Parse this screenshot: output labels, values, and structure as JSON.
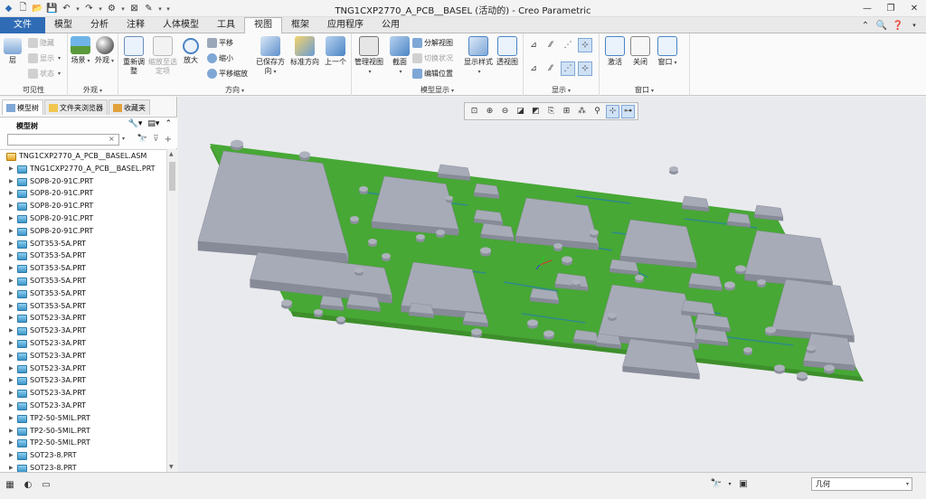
{
  "window": {
    "title": "TNG1CXP2770_A_PCB__BASEL (活动的) - Creo Parametric"
  },
  "ribbon_tabs": [
    {
      "label": "文件"
    },
    {
      "label": "模型"
    },
    {
      "label": "分析"
    },
    {
      "label": "注释"
    },
    {
      "label": "人体模型"
    },
    {
      "label": "工具"
    },
    {
      "label": "视图"
    },
    {
      "label": "框架"
    },
    {
      "label": "应用程序"
    },
    {
      "label": "公用"
    }
  ],
  "active_tab": "视图",
  "ribbon": {
    "visibility": {
      "label": "可见性",
      "layer": "层",
      "hide": "隐藏",
      "show": "显示",
      "status": "状态"
    },
    "appearance": {
      "label": "外观",
      "scene": "场景",
      "appearance": "外观"
    },
    "orientation": {
      "label": "方向",
      "refit": "重新调整",
      "zoom_to_selected": "缩放至选定项",
      "zoom_in": "放大",
      "pan": "平移",
      "zoom_out": "缩小",
      "pan_zoom": "平移缩放",
      "saved_views": "已保存方向",
      "standard_orientation": "标准方向",
      "previous": "上一个"
    },
    "model_display": {
      "label": "模型显示",
      "manage_views": "管理视图",
      "section": "截面",
      "exploded_view": "分解视图",
      "toggle_status": "切换状况",
      "edit_position": "编辑位置",
      "display_style": "显示样式",
      "perspective": "透视图"
    },
    "display": {
      "label": "显示"
    },
    "window": {
      "label": "窗口",
      "activate": "激活",
      "close": "关闭",
      "windows": "窗口"
    }
  },
  "panel": {
    "tabs": [
      {
        "label": "模型树"
      },
      {
        "label": "文件夹浏览器"
      },
      {
        "label": "收藏夹"
      }
    ],
    "tree_title": "模型树",
    "search_value": "",
    "tree": {
      "root": "TNG1CXP2770_A_PCB__BASEL.ASM",
      "items": [
        "TNG1CXP2770_A_PCB__BASEL.PRT",
        "SOP8-20-91C.PRT",
        "SOP8-20-91C.PRT",
        "SOP8-20-91C.PRT",
        "SOP8-20-91C.PRT",
        "SOP8-20-91C.PRT",
        "SOT353-5A.PRT",
        "SOT353-5A.PRT",
        "SOT353-5A.PRT",
        "SOT353-5A.PRT",
        "SOT353-5A.PRT",
        "SOT353-5A.PRT",
        "SOT523-3A.PRT",
        "SOT523-3A.PRT",
        "SOT523-3A.PRT",
        "SOT523-3A.PRT",
        "SOT523-3A.PRT",
        "SOT523-3A.PRT",
        "SOT523-3A.PRT",
        "SOT523-3A.PRT",
        "TP2-50-5MIL.PRT",
        "TP2-50-5MIL.PRT",
        "TP2-50-5MIL.PRT",
        "SOT23-8.PRT",
        "SOT23-8.PRT"
      ]
    }
  },
  "status": {
    "filter_value": "几何"
  },
  "colors": {
    "file_tab": "#2f6cb5",
    "pcb_green": "#43a832",
    "component_gray": "#a4a8b4",
    "graphics_bg": "#e9eaee"
  }
}
